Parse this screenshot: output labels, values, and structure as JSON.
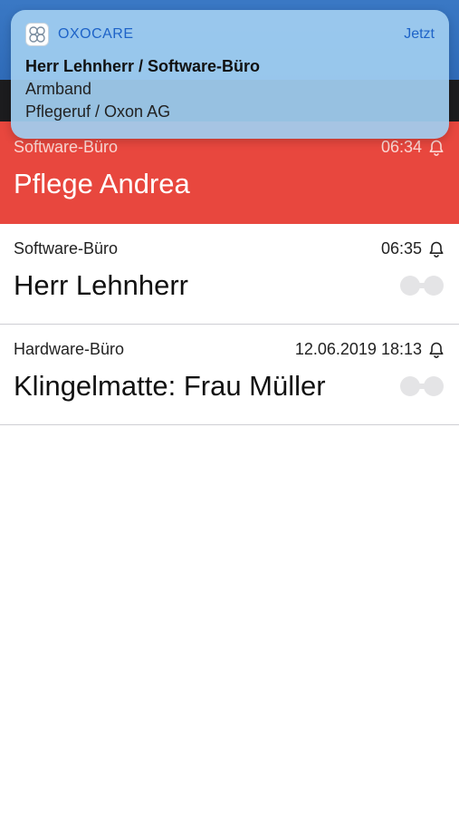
{
  "notification": {
    "app_name": "OXOCARE",
    "time": "Jetzt",
    "title": "Herr Lehnherr / Software-Büro",
    "line1": "Armband",
    "line2": "Pflegeruf / Oxon AG",
    "icon": "oxocare-app-icon"
  },
  "active_alarm": {
    "location": "Software-Büro",
    "time": "06:34",
    "name": "Pflege Andrea",
    "icon": "bell-icon"
  },
  "alarms": [
    {
      "location": "Software-Büro",
      "time": "06:35",
      "name": "Herr Lehnherr",
      "icon": "bell-icon"
    },
    {
      "location": "Hardware-Büro",
      "time": "12.06.2019 18:13",
      "name": "Klingelmatte: Frau Müller",
      "icon": "bell-icon"
    }
  ],
  "colors": {
    "header_blue": "#2f6bb8",
    "active_red": "#e8473e",
    "notification_bg": "#a0cdf0",
    "accent_blue": "#1e63c8"
  }
}
